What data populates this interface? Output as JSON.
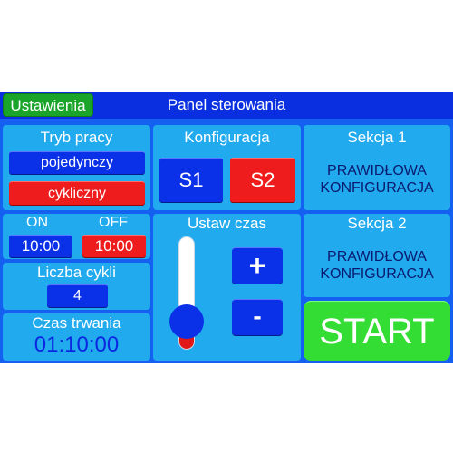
{
  "header": {
    "settings_label": "Ustawienia",
    "title": "Panel sterowania"
  },
  "mode": {
    "title": "Tryb pracy",
    "single": "pojedynczy",
    "cyclic": "cykliczny"
  },
  "onoff": {
    "on_label": "ON",
    "off_label": "OFF",
    "on_value": "10:00",
    "off_value": "10:00"
  },
  "cycles": {
    "title": "Liczba cykli",
    "value": "4"
  },
  "duration": {
    "title": "Czas trwania",
    "value": "01:10:00"
  },
  "config": {
    "title": "Konfiguracja",
    "s1": "S1",
    "s2": "S2"
  },
  "set_time": {
    "title": "Ustaw czas",
    "plus": "+",
    "minus": "-",
    "slider_level": 0
  },
  "section1": {
    "title": "Sekcja 1",
    "line1": "PRAWIDŁOWA",
    "line2": "KONFIGURACJA"
  },
  "section2": {
    "title": "Sekcja 2",
    "line1": "PRAWIDŁOWA",
    "line2": "KONFIGURACJA"
  },
  "start": {
    "label": "START"
  },
  "colors": {
    "panel": "#22aaee",
    "background": "#1460f0",
    "blue_button": "#0a30e8",
    "red_button": "#ee1c1c",
    "start": "#33dd33",
    "settings": "#1aa52a"
  }
}
